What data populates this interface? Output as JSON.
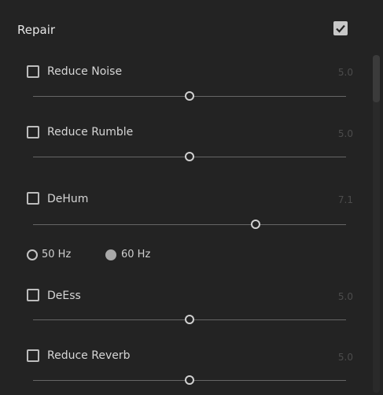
{
  "header": {
    "title": "Repair",
    "enabled": true
  },
  "effects": [
    {
      "label": "Reduce Noise",
      "value": "5.0",
      "checked": false,
      "level": 0.5
    },
    {
      "label": "Reduce Rumble",
      "value": "5.0",
      "checked": false,
      "level": 0.5
    },
    {
      "label": "DeHum",
      "value": "7.1",
      "checked": false,
      "level": 0.71
    },
    {
      "label": "DeEss",
      "value": "5.0",
      "checked": false,
      "level": 0.5
    },
    {
      "label": "Reduce Reverb",
      "value": "5.0",
      "checked": false,
      "level": 0.5
    }
  ],
  "dehum_frequency": {
    "options": [
      {
        "label": "50 Hz",
        "selected": false
      },
      {
        "label": "60 Hz",
        "selected": true
      }
    ]
  },
  "colors": {
    "background": "#232323",
    "text": "#d6d6d6",
    "value_text": "#4c4c4c",
    "track": "#666666",
    "thumb_border": "#d0d0d0",
    "header_checkbox": "#c8c8c8"
  }
}
